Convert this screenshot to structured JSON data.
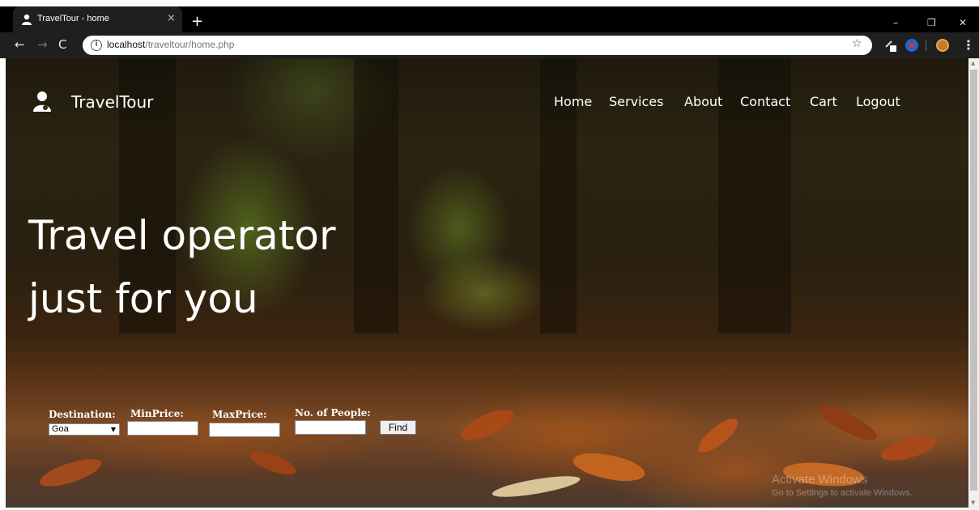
{
  "browser": {
    "tab_title": "TravelTour - home",
    "tab_close": "×",
    "new_tab": "+",
    "window_controls": {
      "minimize": "–",
      "restore": "❐",
      "close": "✕"
    },
    "nav": {
      "back": "←",
      "forward": "→",
      "reload": "C"
    },
    "url_host": "localhost",
    "url_path": "/traveltour/home.php",
    "star": "☆",
    "menu": "⋮"
  },
  "site": {
    "brand": "TravelTour",
    "nav_items": [
      "Home",
      "Services",
      "About",
      "Contact",
      "Cart",
      "Logout"
    ],
    "hero_line1": "Travel operator",
    "hero_line2": "just for you"
  },
  "search_form": {
    "destination_label": "Destination:",
    "destination_value": "Goa",
    "minprice_label": "MinPrice:",
    "minprice_value": "",
    "maxprice_label": "MaxPrice:",
    "maxprice_value": "",
    "people_label": "No. of People:",
    "people_value": "",
    "find_label": "Find"
  },
  "watermark": {
    "line1": "Activate Windows",
    "line2": "Go to Settings to activate Windows."
  },
  "colors": {
    "tab_bar": "#000000",
    "toolbar": "#1f1f1f",
    "text_white": "#ffffff"
  },
  "icons": [
    "user-icon",
    "info-icon",
    "star-icon",
    "extension-icon",
    "profile-avatar",
    "menu-icon"
  ]
}
